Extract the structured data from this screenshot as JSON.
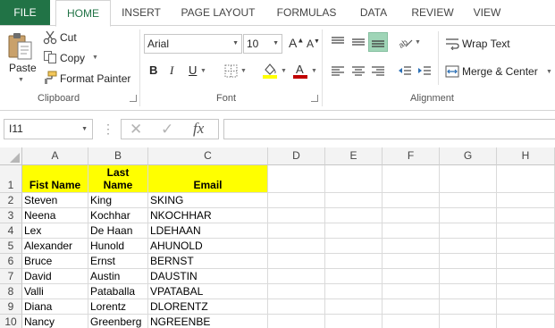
{
  "tabs": {
    "file": "FILE",
    "home": "HOME",
    "insert": "INSERT",
    "page_layout": "PAGE LAYOUT",
    "formulas": "FORMULAS",
    "data": "DATA",
    "review": "REVIEW",
    "view": "VIEW"
  },
  "clipboard": {
    "paste": "Paste",
    "cut": "Cut",
    "copy": "Copy",
    "format_painter": "Format Painter",
    "group_label": "Clipboard"
  },
  "font": {
    "name": "Arial",
    "size": "10",
    "bold": "B",
    "italic": "I",
    "underline": "U",
    "group_label": "Font",
    "fill_color": "#ffff00",
    "font_color": "#c00000"
  },
  "alignment": {
    "wrap_text": "Wrap Text",
    "merge_center": "Merge & Center",
    "group_label": "Alignment"
  },
  "formula_bar": {
    "name_box": "I11",
    "fx": "fx",
    "formula": ""
  },
  "sheet": {
    "columns": [
      "A",
      "B",
      "C",
      "D",
      "E",
      "F",
      "G",
      "H"
    ],
    "row_numbers": [
      "1",
      "2",
      "3",
      "4",
      "5",
      "6",
      "7",
      "8",
      "9",
      "10"
    ],
    "header": {
      "first_name": "Fist Name",
      "last_name_line1": "Last",
      "last_name_line2": "Name",
      "email": "Email"
    },
    "rows": [
      [
        "Steven",
        "King",
        "SKING"
      ],
      [
        "Neena",
        "Kochhar",
        "NKOCHHAR"
      ],
      [
        "Lex",
        "De Haan",
        "LDEHAAN"
      ],
      [
        "Alexander",
        "Hunold",
        "AHUNOLD"
      ],
      [
        "Bruce",
        "Ernst",
        "BERNST"
      ],
      [
        "David",
        "Austin",
        "DAUSTIN"
      ],
      [
        "Valli",
        "Pataballa",
        "VPATABAL"
      ],
      [
        "Diana",
        "Lorentz",
        "DLORENTZ"
      ],
      [
        "Nancy",
        "Greenberg",
        "NGREENBE"
      ]
    ],
    "header_fill": "#ffff00"
  },
  "theme": {
    "accent": "#217346"
  }
}
